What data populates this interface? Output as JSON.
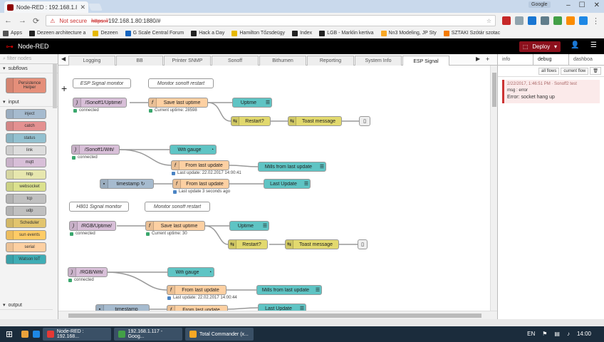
{
  "browser": {
    "tab_title": "Node-RED : 192.168.1.80",
    "user_tag": "Google",
    "not_secure": "Not secure",
    "url_scheme": "https://",
    "url_rest": "192.168.1.80:1880/#",
    "bookmarks": [
      {
        "label": "Apps",
        "color": "#555"
      },
      {
        "label": "Dezeen architecture a",
        "color": "#222"
      },
      {
        "label": "Dezeen",
        "color": "#e6b800"
      },
      {
        "label": "G Scale Central Forum",
        "color": "#1565c0"
      },
      {
        "label": "Hack a Day",
        "color": "#222"
      },
      {
        "label": "Hamilton Tőzsdeügy",
        "color": "#e6b800"
      },
      {
        "label": "Index",
        "color": "#222"
      },
      {
        "label": "LGB - Marklin kertiva",
        "color": "#222"
      },
      {
        "label": "Nn3 Modeling, JP Sty",
        "color": "#f9a825"
      },
      {
        "label": "SZTAKI Szótár szotac",
        "color": "#f57c00"
      }
    ]
  },
  "header": {
    "title": "Node-RED",
    "deploy": "Deploy"
  },
  "palette": {
    "filter_placeholder": "filter nodes",
    "categories": {
      "subflows": "subflows",
      "input": "input",
      "output": "output"
    },
    "subflow_node": "Persistence Helper",
    "input_nodes": [
      {
        "label": "inject",
        "color": "#a6bbcf"
      },
      {
        "label": "catch",
        "color": "#e49191"
      },
      {
        "label": "status",
        "color": "#94c1d0"
      },
      {
        "label": "link",
        "color": "#dddddd"
      },
      {
        "label": "mqtt",
        "color": "#d8bfd8"
      },
      {
        "label": "http",
        "color": "#e7e7ae"
      },
      {
        "label": "websocket",
        "color": "#dbe18e"
      },
      {
        "label": "tcp",
        "color": "#c0c0c0"
      },
      {
        "label": "udp",
        "color": "#c0c0c0"
      },
      {
        "label": "Scheduler",
        "color": "#e2c56e"
      },
      {
        "label": "sun events",
        "color": "#ffcc66"
      },
      {
        "label": "serial",
        "color": "#fdd0a2"
      },
      {
        "label": "Watson IoT",
        "color": "#3fadb5"
      }
    ]
  },
  "workspace": {
    "tabs": [
      "Logging",
      "BB",
      "Printer SNMP",
      "Sonoff",
      "Bithumen",
      "Reporting",
      "System Info",
      "ESP Signal"
    ],
    "active_tab": "ESP Signal",
    "comments": [
      "ESP Signal monitor",
      "Monitor sonoff restart",
      "H801 Signal monitor",
      "Monitor sonoff restart"
    ],
    "nodes": {
      "mqtt_uptime1": "/Sonoff1/Uptime/",
      "save_uptime": "Save last uptime",
      "uptime": "Uptime",
      "restart": "Restart?",
      "toast": "Toast message",
      "mqtt_wifi1": "/Sonoff1/Wifi/",
      "wifi_gauge": "Wifi gauge",
      "from_last_update": "From last update",
      "mills_update": "Mills from last update",
      "timestamp": "timestamp ↻",
      "last_update": "Last Update",
      "mqtt_uptime2": "/RGB/Uptime/",
      "mqtt_wifi2": "/RGB/Wifi/",
      "timestamp2": "timestamp"
    },
    "status": {
      "connected": "connected",
      "current_uptime1": "Current uptime: 28598",
      "last_update1": "Last update: 22.02.2017 14:00:41",
      "last_update_ago": "Last update 3 seconds ago",
      "current_uptime2": "Current uptime: 30",
      "last_update2": "Last update: 22.02.2017 14:00:44"
    }
  },
  "sidebar": {
    "tabs": [
      "info",
      "debug",
      "dashboa"
    ],
    "active": "debug",
    "filter_all": "all flows",
    "filter_current": "current flow",
    "msg_meta": "2/22/2017, 1:46:51 PM · Sonoff2 test",
    "msg_type": "msg : error",
    "msg_text": "Error: socket hang up"
  },
  "taskbar": {
    "items": [
      "Node-RED : 192.168...",
      "192.168.1.117 - Goog...",
      "Total Commander (x..."
    ],
    "lang": "EN",
    "time": "14:00"
  }
}
